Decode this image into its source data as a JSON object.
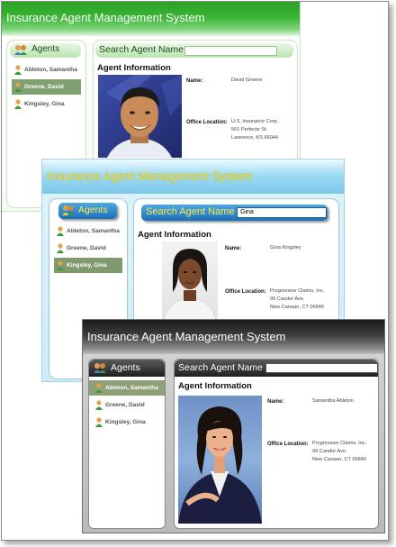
{
  "windows": [
    {
      "theme": "green",
      "title": "Insurance Agent Management System",
      "agents_header": "Agents",
      "search_label": "Search Agent Name",
      "search_value": "",
      "section_title": "Agent Information",
      "agents": [
        "Ableton, Samantha",
        "Greene, David",
        "Kingsley, Gina"
      ],
      "selected": 1,
      "name_label": "Name:",
      "name_value": "David Greene",
      "office_label": "Office Location:",
      "office_lines": [
        "U.S. Insurance Corp.",
        "561 Perfecte St.",
        "Lawrence, KS 66044"
      ]
    },
    {
      "theme": "blue",
      "title": "Insurance Agent Management System",
      "agents_header": "Agents",
      "search_label": "Search Agent Name",
      "search_value": "Gina",
      "section_title": "Agent Information",
      "agents": [
        "Ableton, Samantha",
        "Greene, David",
        "Kingsley, Gina"
      ],
      "selected": 2,
      "name_label": "Name:",
      "name_value": "Gina Kingsley",
      "office_label": "Office Location:",
      "office_lines": [
        "Progressive Claims, Inc.",
        "99 Candor Ave.",
        "New Canaan, CT 06840"
      ]
    },
    {
      "theme": "gray",
      "title": "Insurance Agent Management System",
      "agents_header": "Agents",
      "search_label": "Search Agent Name",
      "search_value": "",
      "section_title": "Agent Information",
      "agents": [
        "Ableton, Samantha",
        "Greene, David",
        "Kingsley, Gina"
      ],
      "selected": 0,
      "name_label": "Name:",
      "name_value": "Samantha Ableton",
      "office_label": "Office Location:",
      "office_lines": [
        "Progressive Claims, Inc.",
        "99 Candor Ave.",
        "New Canaan, CT 06840"
      ]
    }
  ],
  "colors": {
    "green_title": "#2fa52a",
    "blue_title": "#8fd8f5",
    "gray_title": "#3a3a3a",
    "green_select": "#7fa070",
    "blue_select": "#7f9a6c",
    "gray_select": "#8fa078"
  }
}
